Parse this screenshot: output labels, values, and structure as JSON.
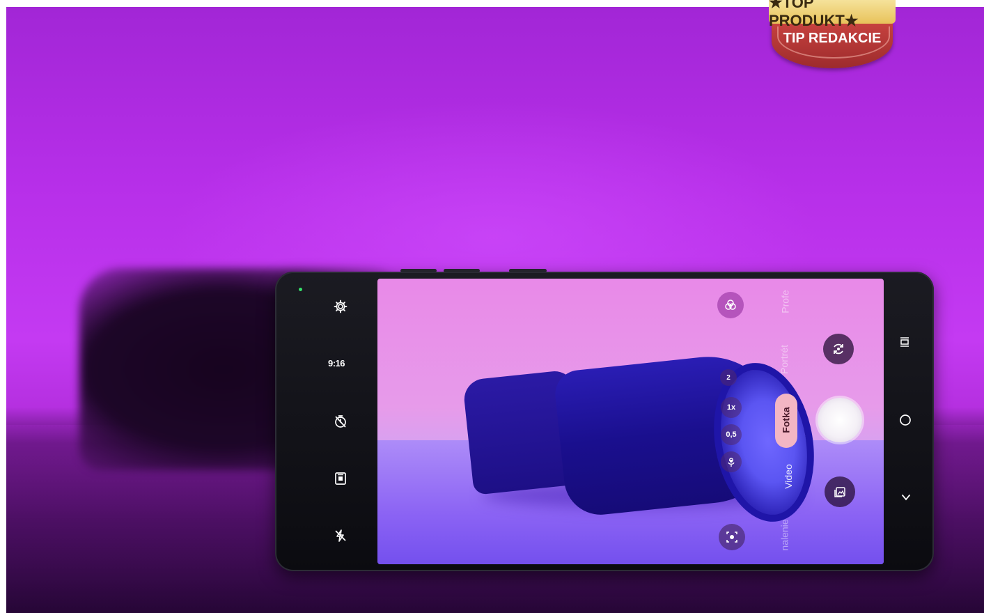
{
  "badge": {
    "top_text": "★TOP PRODUKT★",
    "bottom_text": "TIP REDAKCIE"
  },
  "camera_app": {
    "left_bar": {
      "settings_icon": "gear-icon",
      "aspect_ratio": "9:16",
      "timer_icon": "timer-off-icon",
      "motion_photo_icon": "motion-photo-icon",
      "flash_icon": "flash-off-icon"
    },
    "top_controls": {
      "filters_icon": "filters-icon"
    },
    "zoom_levels": [
      "2",
      "1x",
      "0,5"
    ],
    "macro_icon": "flower-icon",
    "lens_icon": "lens-icon",
    "modes": {
      "pro": "Profe",
      "portrait": "Portrét",
      "photo": "Fotka",
      "video": "Video",
      "more": "nalenie"
    },
    "switch_camera_icon": "switch-camera-icon",
    "gallery_icon": "gallery-icon",
    "nav": {
      "recents_icon": "recents-icon",
      "home_icon": "home-icon",
      "back_icon": "back-icon"
    }
  }
}
